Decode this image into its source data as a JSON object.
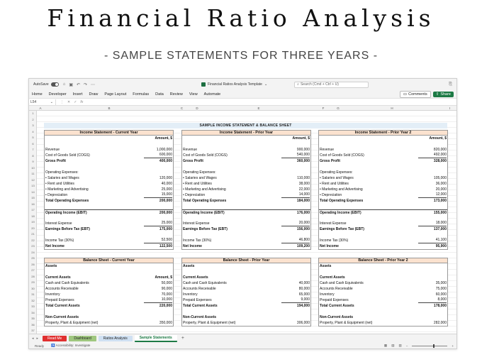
{
  "hero": {
    "title": "Financial Ratio Analysis",
    "subtitle": "- SAMPLE STATEMENTS FOR THREE YEARS -"
  },
  "window": {
    "autosave_label": "AutoSave",
    "doc_title": "Financial Ratios Analysis Template",
    "search_placeholder": "Search (Cmd + Ctrl + U)"
  },
  "ribbon": {
    "tabs": [
      "Home",
      "Developer",
      "Insert",
      "Draw",
      "Page Layout",
      "Formulas",
      "Data",
      "Review",
      "View",
      "Automate"
    ],
    "comments_label": "Comments",
    "share_label": "Share"
  },
  "formula_bar": {
    "cell_ref": "L54",
    "fx": "fx"
  },
  "columns": [
    "A",
    "B",
    "C",
    "D",
    "E",
    "F",
    "G",
    "H",
    "I"
  ],
  "rows": [
    "1",
    "2",
    "3",
    "4",
    "5",
    "6",
    "7",
    "8",
    "9",
    "10",
    "11",
    "12",
    "13",
    "14",
    "15",
    "16",
    "17",
    "18",
    "19",
    "20",
    "21",
    "22",
    "23",
    "24",
    "25",
    "26",
    "27",
    "28",
    "29",
    "30",
    "31",
    "32",
    "33",
    "34",
    "35",
    "36",
    "37"
  ],
  "sheet_title": "SAMPLE INCOME STATEMENT & BALANCE SHEET",
  "income": [
    {
      "heading": "Income Statement - Current Year",
      "amount_label": "Amount, $",
      "revenue_label": "Revenue",
      "revenue": "1,000,000",
      "cogs_label": "Cost of Goods Sold (COGS)",
      "cogs": "600,000",
      "gross_label": "Gross Profit",
      "gross": "400,000",
      "opex_label": "Operating Expenses:",
      "salaries_label": "• Salaries and Wages",
      "salaries": "120,000",
      "rent_label": "• Rent and Utilities",
      "rent": "40,000",
      "marketing_label": "• Marketing and Advertising",
      "marketing": "25,000",
      "depreciation_label": "• Depreciation",
      "depreciation": "15,000",
      "total_opex_label": "Total Operating Expenses",
      "total_opex": "200,000",
      "ebit_label": "Operating Income (EBIT)",
      "ebit": "200,000",
      "interest_label": "Interest Expense",
      "interest": "25,000",
      "ebt_label": "Earnings Before Tax (EBT)",
      "ebt": "175,000",
      "tax_label": "Income Tax (30%)",
      "tax": "52,500",
      "net_label": "Net Income",
      "net": "122,500"
    },
    {
      "heading": "Income Statement - Prior Year",
      "amount_label": "Amount, $",
      "revenue_label": "Revenue",
      "revenue": "900,000",
      "cogs_label": "Cost of Goods Sold (COGS)",
      "cogs": "540,000",
      "gross_label": "Gross Profit",
      "gross": "360,000",
      "opex_label": "Operating Expenses:",
      "salaries_label": "• Salaries and Wages",
      "salaries": "110,000",
      "rent_label": "• Rent and Utilities",
      "rent": "38,000",
      "marketing_label": "• Marketing and Advertising",
      "marketing": "22,000",
      "depreciation_label": "• Depreciation",
      "depreciation": "14,000",
      "total_opex_label": "Total Operating Expenses",
      "total_opex": "184,000",
      "ebit_label": "Operating Income (EBIT)",
      "ebit": "176,000",
      "interest_label": "Interest Expense",
      "interest": "20,000",
      "ebt_label": "Earnings Before Tax (EBT)",
      "ebt": "156,000",
      "tax_label": "Income Tax (30%)",
      "tax": "46,800",
      "net_label": "Net Income",
      "net": "109,200"
    },
    {
      "heading": "Income Statement - Prior Year 2",
      "amount_label": "Amount, $",
      "revenue_label": "Revenue",
      "revenue": "820,000",
      "cogs_label": "Cost of Goods Sold (COGS)",
      "cogs": "492,000",
      "gross_label": "Gross Profit",
      "gross": "328,000",
      "opex_label": "Operating Expenses:",
      "salaries_label": "• Salaries and Wages",
      "salaries": "105,000",
      "rent_label": "• Rent and Utilities",
      "rent": "36,000",
      "marketing_label": "• Marketing and Advertising",
      "marketing": "20,000",
      "depreciation_label": "• Depreciation",
      "depreciation": "12,000",
      "total_opex_label": "Total Operating Expenses",
      "total_opex": "173,000",
      "ebit_label": "Operating Income (EBIT)",
      "ebit": "155,000",
      "interest_label": "Interest Expense",
      "interest": "18,000",
      "ebt_label": "Earnings Before Tax (EBT)",
      "ebt": "137,000",
      "tax_label": "Income Tax (30%)",
      "tax": "41,100",
      "net_label": "Net Income",
      "net": "95,900"
    }
  ],
  "balance": [
    {
      "heading": "Balance Sheet - Current Year",
      "assets_label": "Assets",
      "current_assets_label": "Current Assets",
      "amount_label": "Amount, $",
      "cash_label": "Cash and Cash Equivalents",
      "cash": "50,000",
      "ar_label": "Accounts Receivable",
      "ar": "90,000",
      "inventory_label": "Inventory",
      "inventory": "70,000",
      "prepaid_label": "Prepaid Expenses",
      "prepaid": "10,000",
      "total_ca_label": "Total Current Assets",
      "total_ca": "220,000",
      "noncurrent_label": "Non-Current Assets",
      "ppe_label": "Property, Plant & Equipment (net)",
      "ppe": "350,000"
    },
    {
      "heading": "Balance Sheet - Prior Year",
      "assets_label": "Assets",
      "current_assets_label": "Current Assets",
      "amount_label": "",
      "cash_label": "Cash and Cash Equivalents",
      "cash": "40,000",
      "ar_label": "Accounts Receivable",
      "ar": "80,000",
      "inventory_label": "Inventory",
      "inventory": "65,000",
      "prepaid_label": "Prepaid Expenses",
      "prepaid": "9,000",
      "total_ca_label": "Total Current Assets",
      "total_ca": "194,000",
      "noncurrent_label": "Non-Current Assets",
      "ppe_label": "Property, Plant & Equipment (net)",
      "ppe": "306,000"
    },
    {
      "heading": "Balance Sheet - Prior Year 2",
      "assets_label": "Assets",
      "current_assets_label": "Current Assets",
      "amount_label": "",
      "cash_label": "Cash and Cash Equivalents",
      "cash": "35,000",
      "ar_label": "Accounts Receivable",
      "ar": "75,000",
      "inventory_label": "Inventory",
      "inventory": "60,000",
      "prepaid_label": "Prepaid Expenses",
      "prepaid": "8,000",
      "total_ca_label": "Total Current Assets",
      "total_ca": "178,000",
      "noncurrent_label": "Non-Current Assets",
      "ppe_label": "Property, Plant & Equipment (net)",
      "ppe": "282,000"
    }
  ],
  "sheet_tabs": [
    "Read Me",
    "Dashboard",
    "Ratios Analysis",
    "Sample Statements"
  ],
  "status": {
    "ready": "Ready",
    "accessibility": "Accessibility: Investigate"
  },
  "colors": {
    "header_fill": "#fbe2cf",
    "banner_fill": "#e3eef7",
    "share_green": "#1d7a45"
  }
}
